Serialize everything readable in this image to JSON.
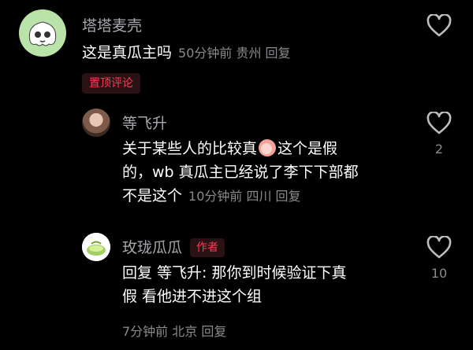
{
  "comments": [
    {
      "username": "塔塔麦壳",
      "text": "这是真瓜主吗",
      "meta": "50分钟前 贵州 回复",
      "pinned_label": "置顶评论",
      "like_count": ""
    },
    {
      "username": "等飞升",
      "text_line1_a": "关于某些人的比较真",
      "text_line1_b": "这个是假",
      "text_line2": "的，wb 真瓜主已经说了李下下部都",
      "text_line3": "不是这个",
      "meta": "10分钟前 四川 回复",
      "like_count": "2"
    },
    {
      "username": "玫珑瓜瓜",
      "author_label": "作者",
      "text_line1": "回复 等飞升: 那你到时候验证下真",
      "text_line2": "假 看他进不进这个组",
      "meta": "7分钟前 北京 回复",
      "like_count": "10"
    }
  ],
  "icons": {
    "like": "heart-outline-icon",
    "emoji": "peach-emoji-icon",
    "avatar_main": "ghost-avatar",
    "avatar_author": "melon-avatar"
  },
  "colors": {
    "background": "#000000",
    "accent": "#ff3b54",
    "muted": "#8a8a8f"
  }
}
